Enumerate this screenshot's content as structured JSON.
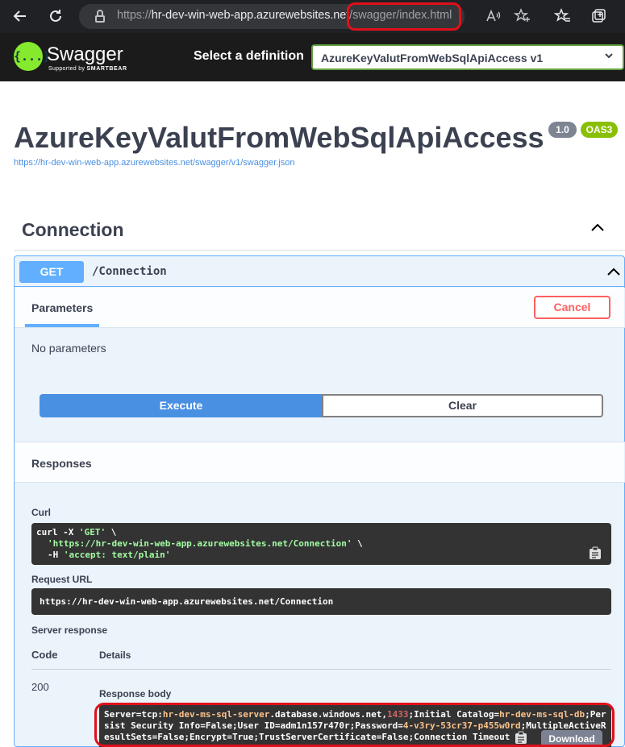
{
  "browser": {
    "url_protocol": "https://",
    "url_host": "hr-dev-win-web-app.azurewebsites.net",
    "url_path": "/swagger/index.html"
  },
  "topbar": {
    "logo_text": "Swagger",
    "logo_glyph": "{...}",
    "logo_sub_prefix": "Supported by",
    "logo_sub_brand": "SMARTBEAR",
    "definition_label": "Select a definition",
    "definition_value": "AzureKeyValutFromWebSqlApiAccess v1"
  },
  "info": {
    "title": "AzureKeyValutFromWebSqlApiAccess",
    "version": "1.0",
    "oas": "OAS3",
    "spec_url": "https://hr-dev-win-web-app.azurewebsites.net/swagger/v1/swagger.json"
  },
  "tag": {
    "name": "Connection"
  },
  "operation": {
    "method": "GET",
    "path": "/Connection",
    "params_tab": "Parameters",
    "cancel_label": "Cancel",
    "no_params": "No parameters",
    "execute_label": "Execute",
    "clear_label": "Clear",
    "responses_title": "Responses",
    "curl_label": "Curl",
    "curl_line1_cmd": "curl -X ",
    "curl_line1_method": "'GET'",
    "curl_line1_end": " \\",
    "curl_line2_url": "'https://hr-dev-win-web-app.azurewebsites.net/Connection'",
    "curl_line2_end": " \\",
    "curl_line3_flag": "-H ",
    "curl_line3_header": "'accept: text/plain'",
    "request_url_label": "Request URL",
    "request_url": "https://hr-dev-win-web-app.azurewebsites.net/Connection",
    "server_response_label": "Server response",
    "code_header": "Code",
    "details_header": "Details",
    "status_code": "200",
    "response_body_label": "Response body",
    "download_label": "Download",
    "body": {
      "p1": "Server=tcp:",
      "p2": "hr-dev-ms-sql-server",
      "p3": ".database.windows.net,",
      "p4": "1433",
      "p5": ";Initial Catalog=",
      "p6": "hr-dev-ms-sql-db",
      "p7": ";Persist Security Info=False;User ID=adm1n157r470r;Password=",
      "p8": "4-v3ry-53cr37-p455w0rd",
      "p9": ";MultipleActiveResultSets=False;Encrypt=True;TrustServerCertificate=False;Connection Timeout"
    }
  },
  "colors": {
    "get_blue": "#61affe",
    "execute_blue": "#4990e2",
    "cancel_red": "#ff6060",
    "swagger_green": "#85ea2d",
    "highlight_red": "#e0101a"
  },
  "icons": [
    "back-arrow-icon",
    "refresh-icon",
    "lock-icon",
    "read-aloud-icon",
    "add-favorite-icon",
    "favorites-icon",
    "collections-icon",
    "chevron-up-icon",
    "chevron-down-icon",
    "copy-icon"
  ]
}
